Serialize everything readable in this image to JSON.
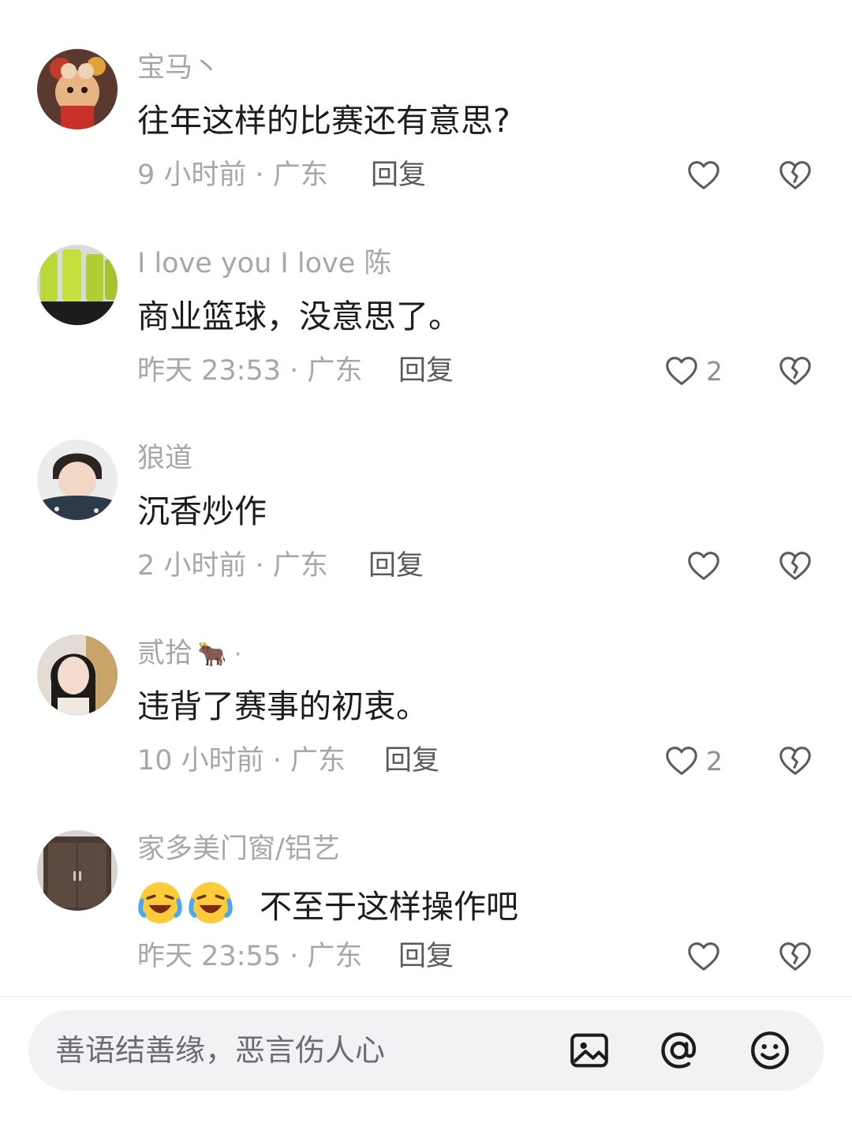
{
  "comments": [
    {
      "username": "宝马丶",
      "text": "往年这样的比赛还有意思?",
      "meta": "9 小时前 · 广东",
      "reply": "回复",
      "likes": ""
    },
    {
      "username": "I love you I love 陈",
      "text": "商业篮球，没意思了。",
      "meta": "昨天 23:53 · 广东",
      "reply": "回复",
      "likes": "2"
    },
    {
      "username": "狼道",
      "text": "沉香炒作",
      "meta": "2 小时前 · 广东",
      "reply": "回复",
      "likes": ""
    },
    {
      "username": "贰拾",
      "username_suffix": "🐂 ·",
      "text": "违背了赛事的初衷。",
      "meta": "10 小时前 · 广东",
      "reply": "回复",
      "likes": "2"
    },
    {
      "username": "家多美门窗/铝艺",
      "text": "不至于这样操作吧",
      "meta": "昨天 23:55 · 广东",
      "reply": "回复",
      "likes": ""
    }
  ],
  "icons": {
    "like": "heart-outline-icon",
    "dislike": "broken-heart-icon",
    "image": "image-icon",
    "mention": "at-icon",
    "emoji": "smiley-icon"
  },
  "input": {
    "placeholder": "善语结善缘，恶言伤人心"
  },
  "colors": {
    "text_primary": "#1c1c1e",
    "text_secondary": "#a7a7ab",
    "input_bg": "#f2f2f4"
  }
}
